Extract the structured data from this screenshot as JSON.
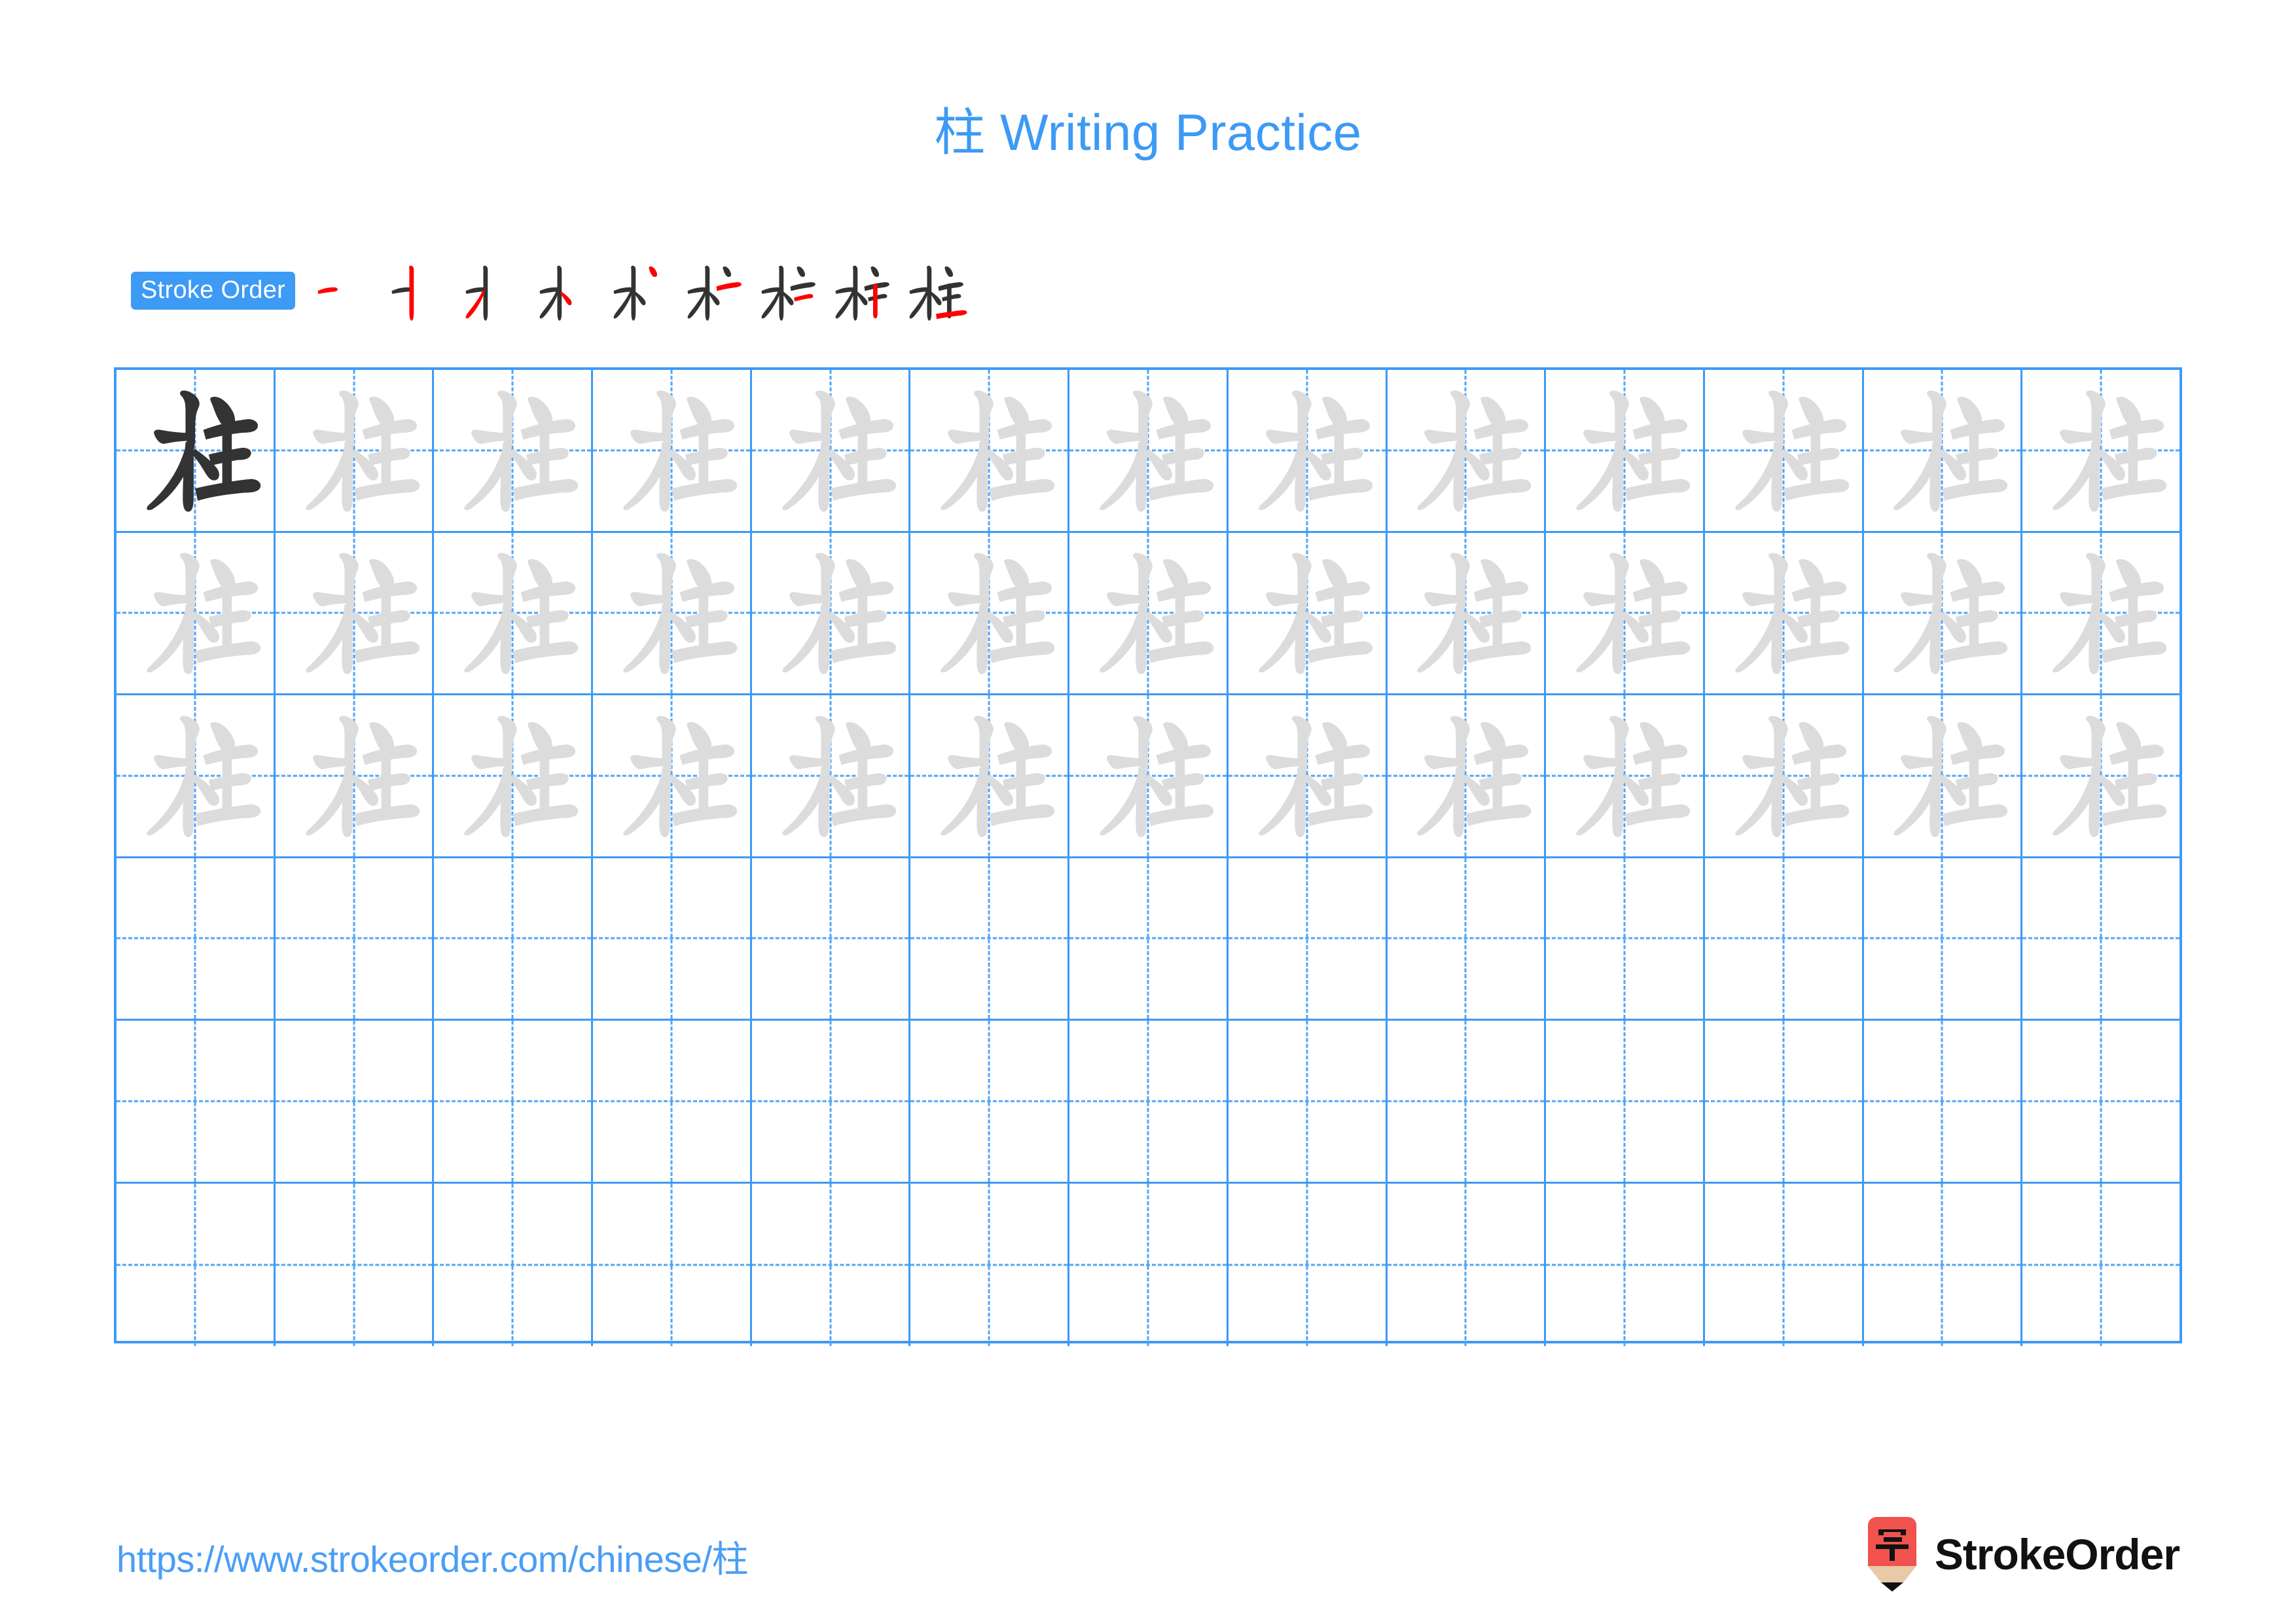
{
  "page": {
    "character": "柱",
    "title_prefix": "柱",
    "title_text": " Writing Practice",
    "title_full": "柱 Writing Practice",
    "accent_color": "#3d9af5",
    "grid_line_color": "#3d9af5",
    "guide_line_color": "#52a5f7",
    "dark_glyph_color": "#333333",
    "trace_glyph_color": "#dcdcdc",
    "background": "#ffffff"
  },
  "stroke_order": {
    "badge_label": "Stroke Order",
    "stroke_count": 9,
    "new_stroke_color": "#ff0000",
    "existing_stroke_color": "#333333",
    "steps": [
      {
        "index": 1,
        "strokes_shown": 1,
        "new_stroke": "héng (horizontal)"
      },
      {
        "index": 2,
        "strokes_shown": 2,
        "new_stroke": "shù (vertical)"
      },
      {
        "index": 3,
        "strokes_shown": 3,
        "new_stroke": "piě (left-falling)"
      },
      {
        "index": 4,
        "strokes_shown": 4,
        "new_stroke": "diǎn (dot)"
      },
      {
        "index": 5,
        "strokes_shown": 5,
        "new_stroke": "diǎn (dot)"
      },
      {
        "index": 6,
        "strokes_shown": 6,
        "new_stroke": "héng (horizontal)"
      },
      {
        "index": 7,
        "strokes_shown": 7,
        "new_stroke": "héng (horizontal)"
      },
      {
        "index": 8,
        "strokes_shown": 8,
        "new_stroke": "shù (vertical)"
      },
      {
        "index": 9,
        "strokes_shown": 9,
        "new_stroke": "héng (bottom horizontal)"
      }
    ]
  },
  "practice_grid": {
    "columns": 13,
    "rows": 6,
    "rows_data": [
      {
        "row": 1,
        "cells": [
          "dark",
          "trace",
          "trace",
          "trace",
          "trace",
          "trace",
          "trace",
          "trace",
          "trace",
          "trace",
          "trace",
          "trace",
          "trace"
        ]
      },
      {
        "row": 2,
        "cells": [
          "trace",
          "trace",
          "trace",
          "trace",
          "trace",
          "trace",
          "trace",
          "trace",
          "trace",
          "trace",
          "trace",
          "trace",
          "trace"
        ]
      },
      {
        "row": 3,
        "cells": [
          "trace",
          "trace",
          "trace",
          "trace",
          "trace",
          "trace",
          "trace",
          "trace",
          "trace",
          "trace",
          "trace",
          "trace",
          "trace"
        ]
      },
      {
        "row": 4,
        "cells": [
          "empty",
          "empty",
          "empty",
          "empty",
          "empty",
          "empty",
          "empty",
          "empty",
          "empty",
          "empty",
          "empty",
          "empty",
          "empty"
        ]
      },
      {
        "row": 5,
        "cells": [
          "empty",
          "empty",
          "empty",
          "empty",
          "empty",
          "empty",
          "empty",
          "empty",
          "empty",
          "empty",
          "empty",
          "empty",
          "empty"
        ]
      },
      {
        "row": 6,
        "cells": [
          "empty",
          "empty",
          "empty",
          "empty",
          "empty",
          "empty",
          "empty",
          "empty",
          "empty",
          "empty",
          "empty",
          "empty",
          "empty"
        ]
      }
    ]
  },
  "footer": {
    "url": "https://www.strokeorder.com/chinese/柱",
    "brand_name": "StrokeOrder",
    "logo_character": "字",
    "logo_body_color": "#f2524e",
    "logo_wood_color": "#e8c9a8",
    "logo_tip_color": "#111111"
  }
}
